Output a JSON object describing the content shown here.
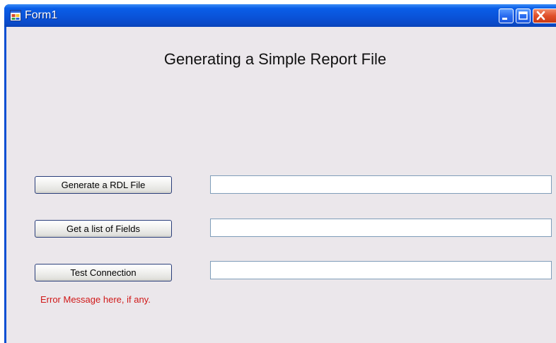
{
  "window": {
    "title": "Form1",
    "icon": "form-app-icon",
    "controls": [
      "minimize-icon",
      "maximize-icon",
      "close-icon"
    ]
  },
  "form": {
    "heading": "Generating a Simple Report File",
    "buttons": {
      "generate_rdl": "Generate a RDL File",
      "get_fields": "Get a list of Fields",
      "test_connection": "Test Connection"
    },
    "fields": {
      "rdl_output": "",
      "fields_output": "",
      "connection_output": ""
    },
    "error_message": "Error Message here, if any."
  },
  "colors": {
    "titlebar": "#0a53d9",
    "client_background": "#ebe7eb",
    "error_text": "#d01818"
  }
}
